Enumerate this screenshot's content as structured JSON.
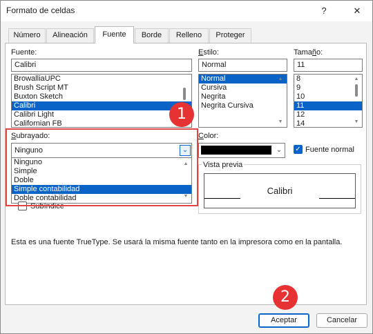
{
  "window": {
    "title": "Formato de celdas",
    "help_glyph": "?",
    "close_glyph": "✕"
  },
  "tabs": [
    {
      "label": "Número"
    },
    {
      "label": "Alineación"
    },
    {
      "label": "Fuente"
    },
    {
      "label": "Borde"
    },
    {
      "label": "Relleno"
    },
    {
      "label": "Proteger"
    }
  ],
  "active_tab": "Fuente",
  "font": {
    "label": "Fuente:",
    "value": "Calibri",
    "list": [
      "BrowalliaUPC",
      "Brush Script MT",
      "Buxton Sketch",
      "Calibri",
      "Calibri Light",
      "Californian FB"
    ],
    "selected": "Calibri"
  },
  "style": {
    "label": "Estilo:",
    "value": "Normal",
    "list": [
      "Normal",
      "Cursiva",
      "Negrita",
      "Negrita Cursiva"
    ],
    "selected": "Normal"
  },
  "size": {
    "label": "Tamaño:",
    "value": "11",
    "list": [
      "8",
      "9",
      "10",
      "11",
      "12",
      "14"
    ],
    "selected": "11"
  },
  "underline": {
    "label": "Subrayado:",
    "value": "Ninguno",
    "options": [
      "Ninguno",
      "Simple",
      "Doble",
      "Simple contabilidad",
      "Doble contabilidad"
    ],
    "highlighted": "Simple contabilidad"
  },
  "color": {
    "label": "Color:",
    "value_hex": "#000000"
  },
  "normal_font": {
    "label": "Fuente normal",
    "checked": true
  },
  "effects": {
    "subscript_label": "Subíndice",
    "checked": false
  },
  "preview": {
    "label": "Vista previa",
    "text": "Calibri"
  },
  "info_text": "Esta es una fuente TrueType. Se usará la misma fuente tanto en la impresora como en la pantalla.",
  "buttons": {
    "ok": "Aceptar",
    "cancel": "Cancelar"
  },
  "callouts": [
    "1",
    "2"
  ],
  "colors": {
    "accent": "#0a64c8",
    "callout": "#e63232"
  }
}
